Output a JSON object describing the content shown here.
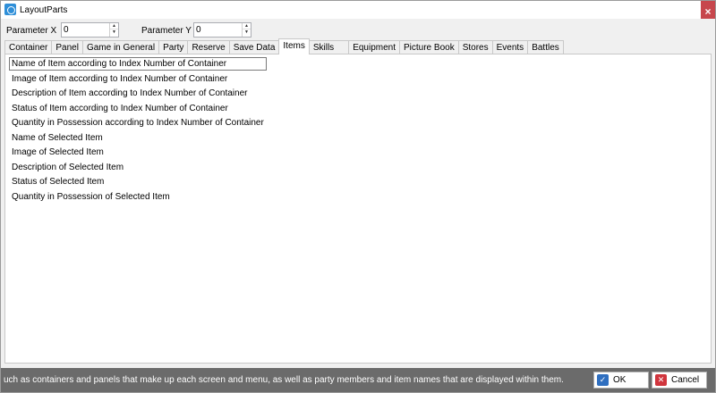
{
  "window": {
    "title": "LayoutParts",
    "close_glyph": "×"
  },
  "params": {
    "x_label": "Parameter X",
    "x_value": "0",
    "y_label": "Parameter Y",
    "y_value": "0"
  },
  "tabs": [
    {
      "label": "Container",
      "active": false
    },
    {
      "label": "Panel",
      "active": false
    },
    {
      "label": "Game in General",
      "active": false
    },
    {
      "label": "Party",
      "active": false
    },
    {
      "label": "Reserve",
      "active": false
    },
    {
      "label": "Save Data",
      "active": false
    },
    {
      "label": "Items",
      "active": true
    },
    {
      "label": "Skills",
      "active": false
    },
    {
      "label": "Equipment",
      "active": false
    },
    {
      "label": "Picture Book",
      "active": false
    },
    {
      "label": "Stores",
      "active": false
    },
    {
      "label": "Events",
      "active": false
    },
    {
      "label": "Battles",
      "active": false
    }
  ],
  "list": [
    "Name of Item according to Index Number of Container",
    "Image of Item according to Index Number of Container",
    "Description of Item according to Index Number of Container",
    "Status of Item according to Index Number of Container",
    "Quantity in Possession according to Index Number of Container",
    "Name of Selected Item",
    "Image of Selected Item",
    "Description of Selected Item",
    "Status of Selected Item",
    "Quantity in Possession of Selected Item"
  ],
  "footer": {
    "description": "uch as containers and panels that make up each screen and menu, as well as party members and item names that are displayed within them.",
    "ok_label": "OK",
    "cancel_label": "Cancel"
  },
  "icons": {
    "app": "app-icon",
    "ok": "checkmark-icon",
    "cancel": "x-icon",
    "spin_up": "▲",
    "spin_down": "▼"
  }
}
